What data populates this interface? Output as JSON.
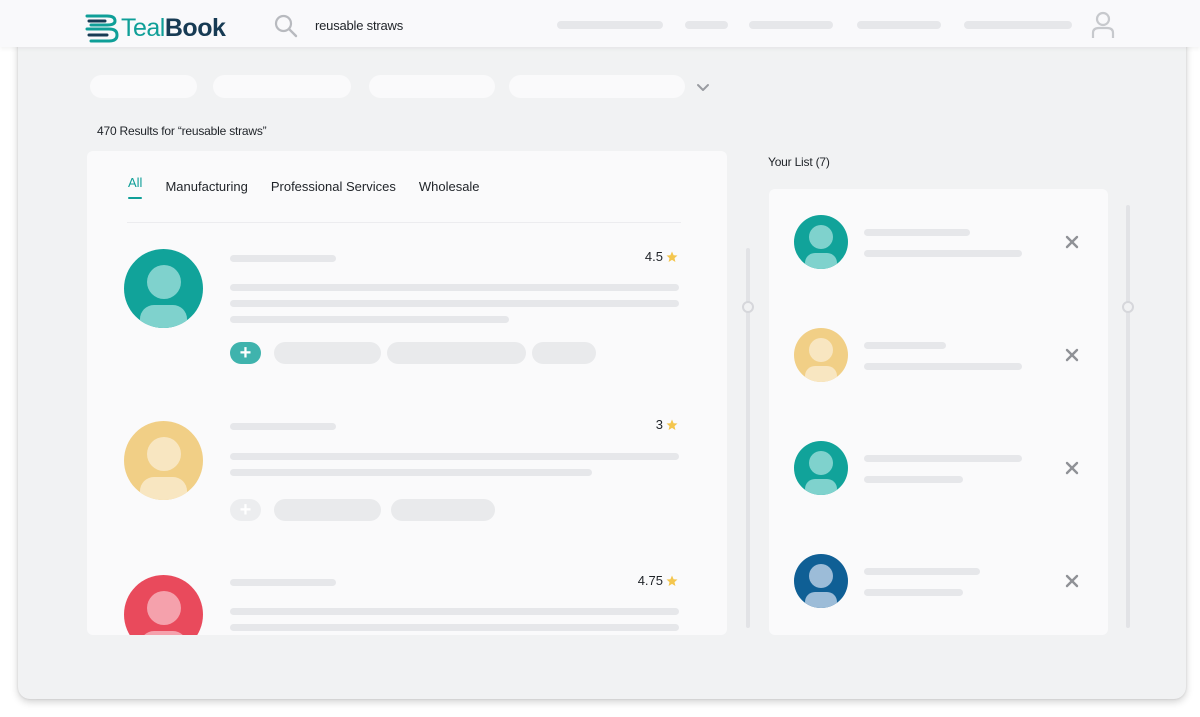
{
  "header": {
    "brand_part1": "Teal",
    "brand_part2": "Book",
    "search_query": "reusable straws"
  },
  "results": {
    "summary": "470 Results for “reusable straws”",
    "tabs": [
      {
        "label": "All",
        "active": true
      },
      {
        "label": "Manufacturing",
        "active": false
      },
      {
        "label": "Professional Services",
        "active": false
      },
      {
        "label": "Wholesale",
        "active": false
      }
    ],
    "rows": [
      {
        "rating": "4.5",
        "avatar_color": "#11a39a",
        "added": true
      },
      {
        "rating": "3",
        "avatar_color": "#f1cf86",
        "added": false
      },
      {
        "rating": "4.75",
        "avatar_color": "#e94a5c",
        "added": false
      }
    ]
  },
  "your_list": {
    "title": "Your List (7)",
    "items": [
      {
        "avatar_color": "#11a39a"
      },
      {
        "avatar_color": "#f1cf86"
      },
      {
        "avatar_color": "#11a39a"
      },
      {
        "avatar_color": "#0f5f95"
      }
    ]
  },
  "colors": {
    "accent": "#0f9f98",
    "star": "#f4c64e",
    "add_active": "#3fb3ad",
    "add_inactive": "#ecedef"
  },
  "icons": {
    "search": "search-icon",
    "user": "user-icon",
    "chevron": "chevron-down-icon",
    "star": "star-icon",
    "close": "close-icon",
    "plus": "plus-icon"
  }
}
